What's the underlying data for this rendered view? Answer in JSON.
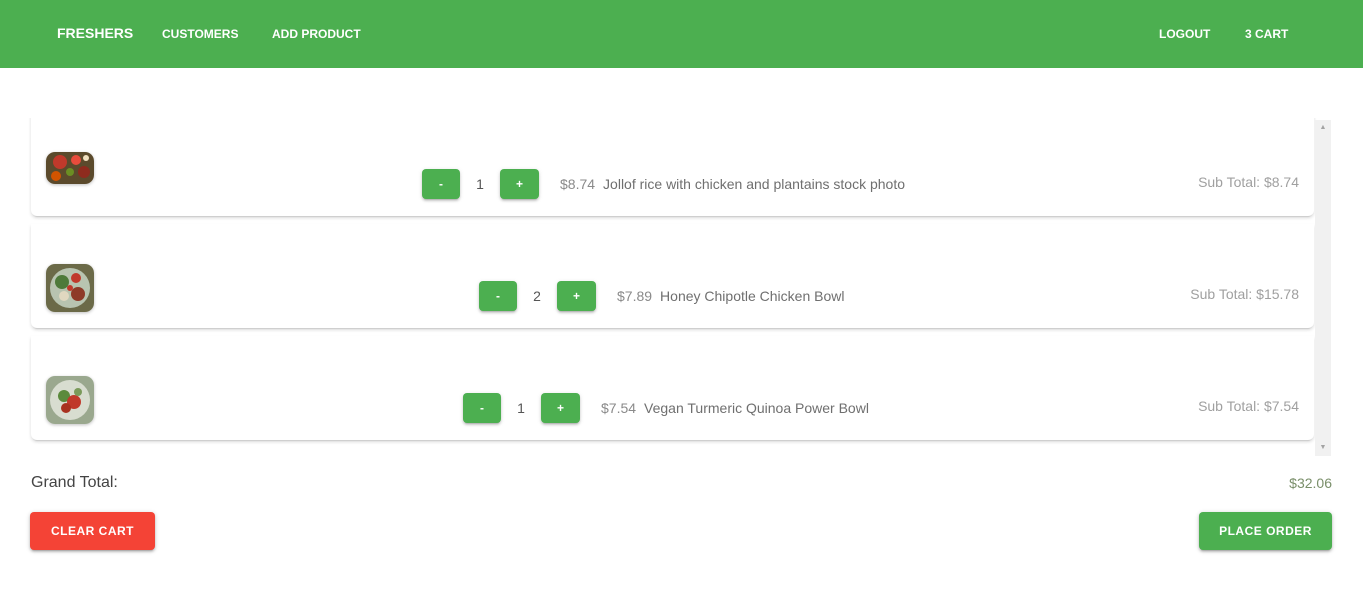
{
  "navbar": {
    "brand": "FRESHERS",
    "links": [
      "CUSTOMERS",
      "ADD PRODUCT"
    ],
    "logout": "LOGOUT",
    "cart": "3 CART",
    "color": "#4caf50"
  },
  "cart": {
    "items": [
      {
        "thumbnail": "food-photo-icon",
        "minus": "-",
        "quantity": "1",
        "plus": "+",
        "price": "$8.74",
        "name": "Jollof rice with chicken and plantains stock photo",
        "subtotal": "Sub Total: $8.74"
      },
      {
        "thumbnail": "food-photo-icon",
        "minus": "-",
        "quantity": "2",
        "plus": "+",
        "price": "$7.89",
        "name": "Honey Chipotle Chicken Bowl",
        "subtotal": "Sub Total: $15.78"
      },
      {
        "thumbnail": "food-photo-icon",
        "minus": "-",
        "quantity": "1",
        "plus": "+",
        "price": "$7.54",
        "name": "Vegan Turmeric Quinoa Power Bowl",
        "subtotal": "Sub Total: $7.54"
      }
    ]
  },
  "totals": {
    "label": "Grand Total:",
    "value": "$32.06"
  },
  "actions": {
    "clear": "CLEAR CART",
    "order": "PLACE ORDER",
    "clear_color": "#f44336",
    "order_color": "#4caf50"
  }
}
